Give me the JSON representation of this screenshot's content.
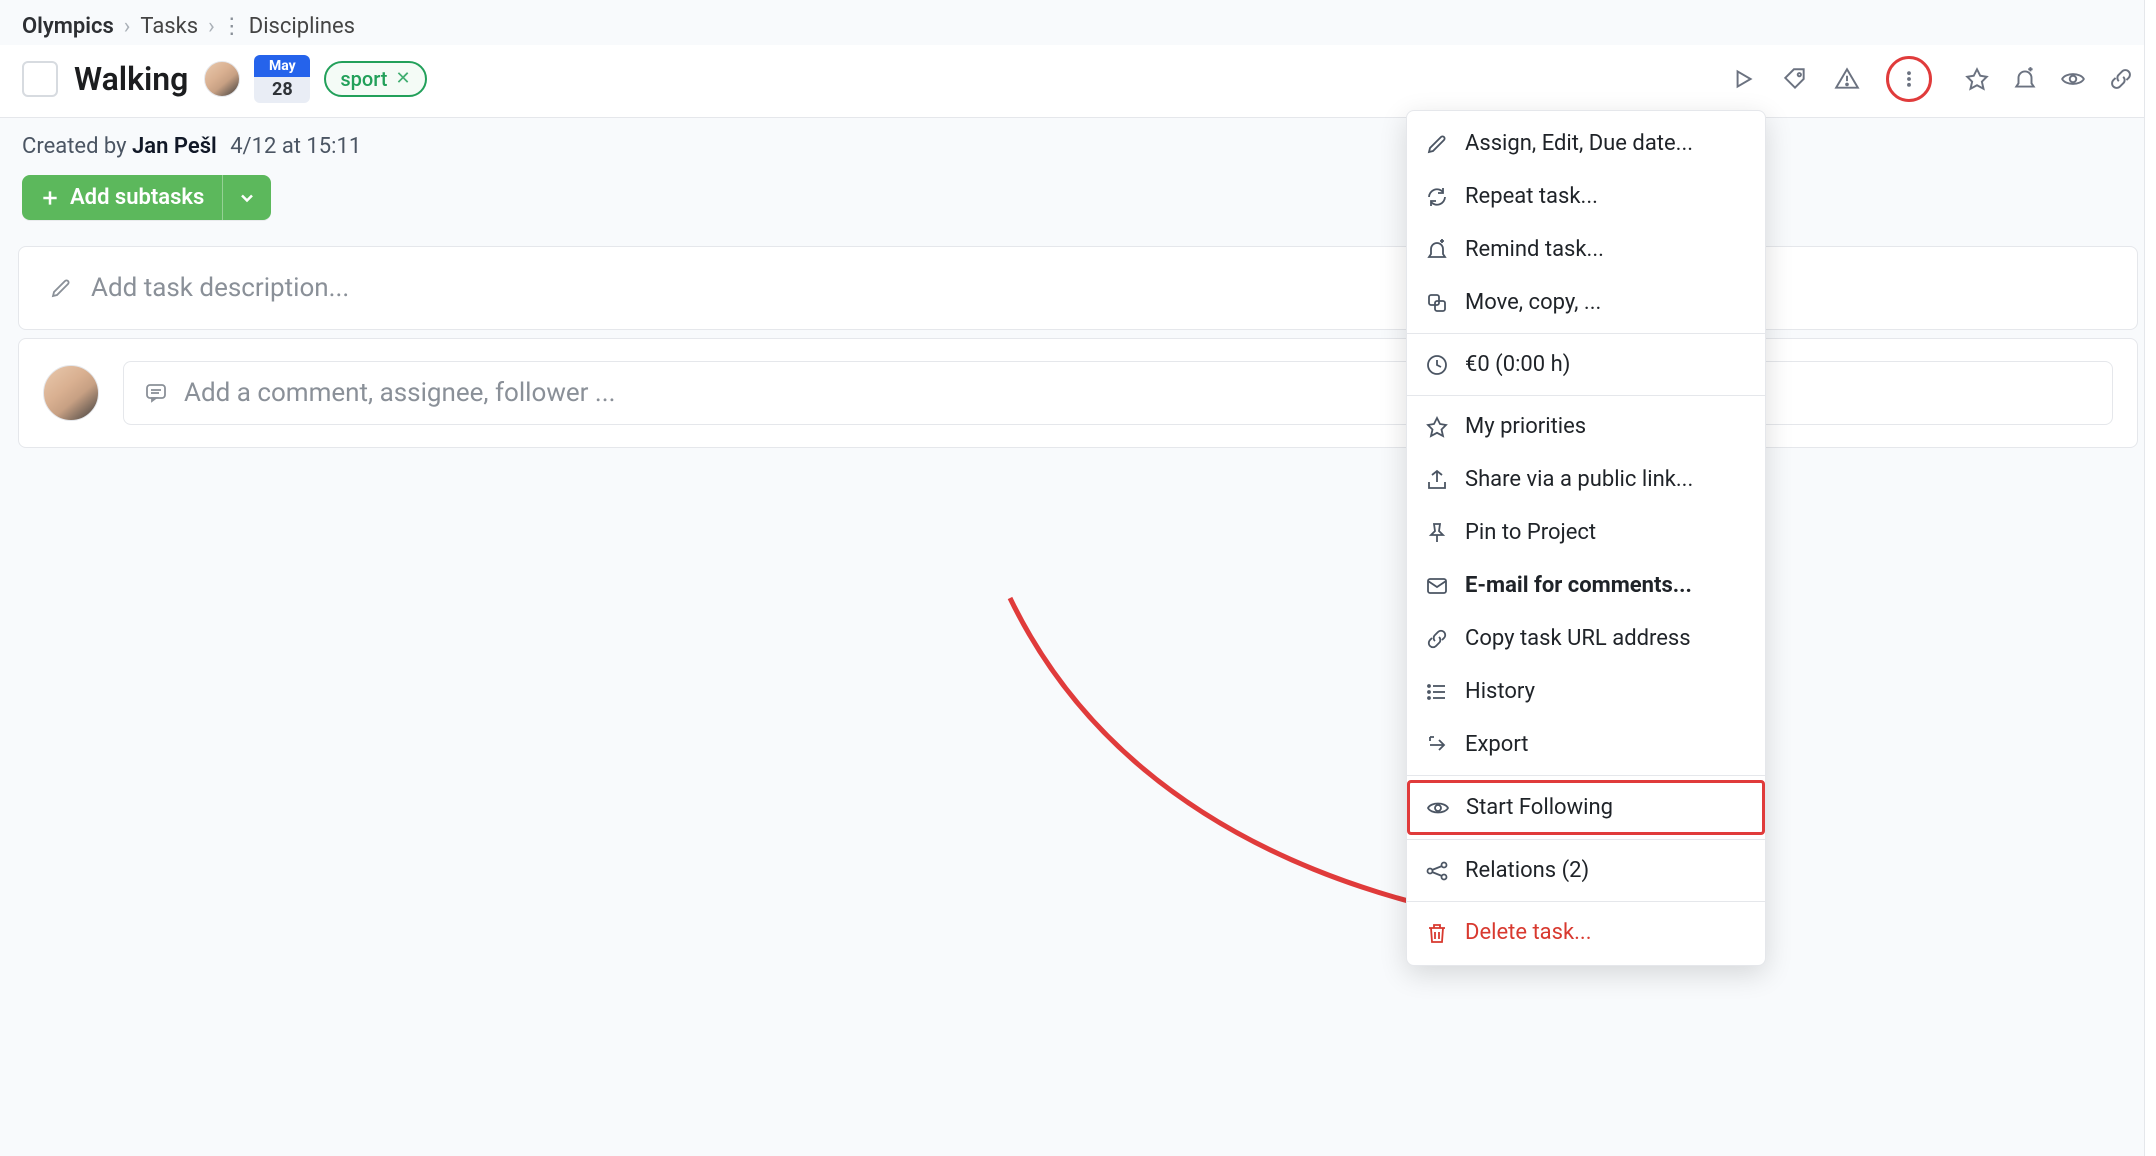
{
  "breadcrumb": {
    "root": "Olympics",
    "level2": "Tasks",
    "level3": "Disciplines"
  },
  "task": {
    "title": "Walking",
    "due_month": "May",
    "due_day": "28",
    "tag_label": "sport"
  },
  "meta": {
    "prefix": "Created by ",
    "author": "Jan Pešl",
    "time": "4/12 at 15:11"
  },
  "buttons": {
    "add_subtasks": "Add subtasks"
  },
  "placeholders": {
    "description": "Add task description...",
    "comment": "Add a comment, assignee, follower ..."
  },
  "menu": {
    "assign": "Assign, Edit, Due date...",
    "repeat": "Repeat task...",
    "remind": "Remind task...",
    "move": "Move, copy, ...",
    "cost": "€0 (0:00 h)",
    "priorities": "My priorities",
    "share": "Share via a public link...",
    "pin": "Pin to Project",
    "email": "E-mail for comments...",
    "copy_url": "Copy task URL address",
    "history": "History",
    "export": "Export",
    "follow": "Start Following",
    "relations": "Relations (2)",
    "delete": "Delete task..."
  }
}
